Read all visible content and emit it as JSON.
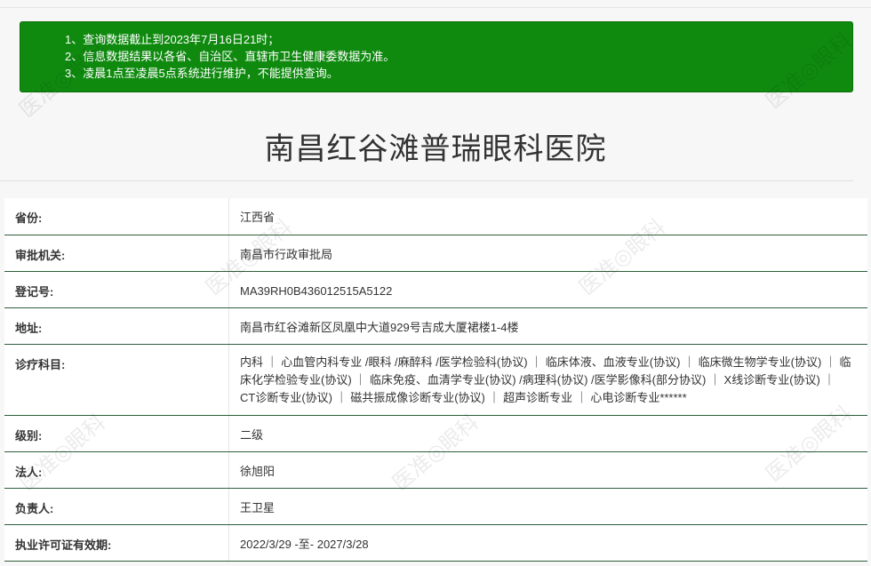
{
  "notice": {
    "items": [
      "1、查询数据截止到2023年7月16日21时；",
      "2、信息数据结果以各省、自治区、直辖市卫生健康委数据为准。",
      "3、凌晨1点至凌晨5点系统进行维护，不能提供查询。"
    ]
  },
  "hospital": {
    "name": "南昌红谷滩普瑞眼科医院"
  },
  "info": {
    "rows": [
      {
        "label": "省份:",
        "value": "江西省"
      },
      {
        "label": "审批机关:",
        "value": "南昌市行政审批局"
      },
      {
        "label": "登记号:",
        "value": "MA39RH0B436012515A5122"
      },
      {
        "label": "地址:",
        "value": "南昌市红谷滩新区凤凰中大道929号吉成大厦裙楼1-4楼"
      },
      {
        "label": "诊疗科目:",
        "value": "内科 ｜ 心血管内科专业 /眼科 /麻醉科 /医学检验科(协议) ｜ 临床体液、血液专业(协议) ｜ 临床微生物学专业(协议) ｜ 临床化学检验专业(协议) ｜ 临床免疫、血清学专业(协议) /病理科(协议) /医学影像科(部分协议) ｜ X线诊断专业(协议) ｜ CT诊断专业(协议) ｜ 磁共振成像诊断专业(协议) ｜ 超声诊断专业 ｜ 心电诊断专业******"
      },
      {
        "label": "级别:",
        "value": "二级"
      },
      {
        "label": "法人:",
        "value": "徐旭阳"
      },
      {
        "label": "负责人:",
        "value": "王卫星"
      },
      {
        "label": "执业许可证有效期:",
        "value": "2022/3/29 -至- 2027/3/28"
      }
    ]
  },
  "watermark": {
    "text": "医准◎眼科"
  }
}
